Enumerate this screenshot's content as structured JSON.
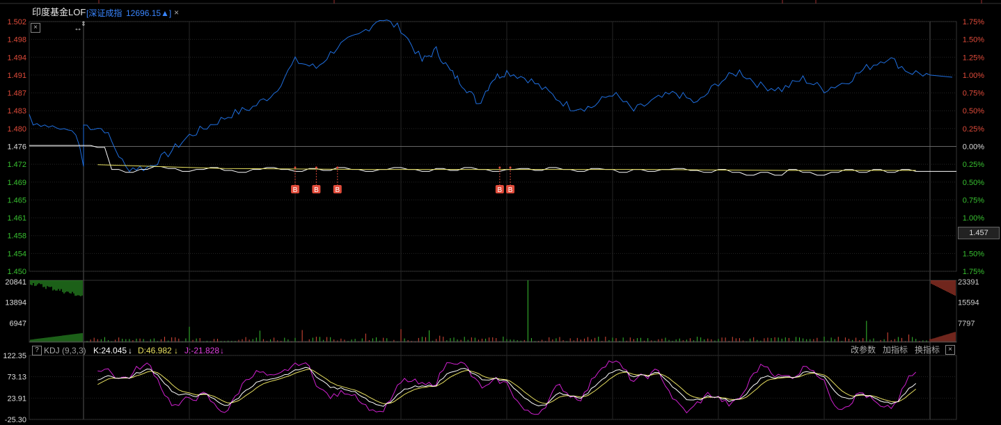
{
  "header": {
    "fund_name": "印度基金LOF",
    "index_name": "[深证成指",
    "index_value": "12696.15",
    "index_arrow": "▲]",
    "close_glyph": "×"
  },
  "price_badge": "1.457",
  "kdj": {
    "help": "?",
    "label": "KDJ",
    "params": "(9,3,3)",
    "k": "K:24.045",
    "k_arrow": "↓",
    "d": "D:46.982",
    "d_arrow": "↓",
    "j": "J:-21.828",
    "j_arrow": "↓",
    "btn_params": "改参数",
    "btn_add": "加指标",
    "btn_switch": "换指标",
    "btn_close": "×"
  },
  "colors": {
    "background": "#000000",
    "grid": "#2a2a2a",
    "price_line": "#ffffff",
    "avg_line": "#e8e060",
    "index_line": "#1f6fe0",
    "up": "#e04b3a",
    "down": "#38c030",
    "k_line": "#ffffff",
    "d_line": "#e8e060",
    "j_line": "#d020d0",
    "marker": "#e04b3a"
  },
  "chart_data": [
    {
      "type": "line",
      "name": "intraday-price",
      "ylim": [
        1.45,
        1.502
      ],
      "y_ticks_left": [
        "1.502",
        "1.498",
        "1.494",
        "1.491",
        "1.487",
        "1.483",
        "1.480",
        "1.476",
        "1.472",
        "1.469",
        "1.465",
        "1.461",
        "1.458",
        "1.454",
        "1.450"
      ],
      "y_ticks_right": [
        "1.75%",
        "1.50%",
        "1.25%",
        "1.00%",
        "0.75%",
        "0.50%",
        "0.25%",
        "0.00%",
        "0.25%",
        "0.50%",
        "0.75%",
        "1.00%",
        "1.25%",
        "1.50%",
        "1.75%"
      ],
      "price_x": [
        0,
        4,
        8,
        12,
        16,
        20,
        24,
        28,
        32,
        36,
        40,
        44,
        48,
        52,
        56,
        60,
        64,
        68,
        72,
        76,
        80,
        84,
        88,
        92,
        96,
        100,
        104,
        108,
        112,
        116,
        120,
        124,
        128,
        132,
        136,
        140,
        144,
        148,
        152,
        156,
        160,
        164,
        168,
        172,
        176,
        180,
        184,
        188,
        192,
        196,
        200,
        204,
        208,
        212,
        216,
        220,
        224,
        228,
        232,
        236,
        240
      ],
      "price_y": [
        1.4762,
        1.4758,
        1.4712,
        1.4706,
        1.4712,
        1.4718,
        1.4714,
        1.4708,
        1.4712,
        1.4716,
        1.471,
        1.4706,
        1.4712,
        1.4716,
        1.4712,
        1.4708,
        1.4714,
        1.471,
        1.4716,
        1.4712,
        1.4708,
        1.4712,
        1.4716,
        1.4712,
        1.4708,
        1.4714,
        1.471,
        1.4716,
        1.4712,
        1.4708,
        1.4712,
        1.4714,
        1.471,
        1.4716,
        1.4712,
        1.4708,
        1.4714,
        1.4712,
        1.4706,
        1.4712,
        1.4708,
        1.4712,
        1.4714,
        1.471,
        1.4706,
        1.4712,
        1.4706,
        1.47,
        1.4706,
        1.47,
        1.4712,
        1.4706,
        1.47,
        1.4706,
        1.4712,
        1.4706,
        1.4712,
        1.4706,
        1.4712,
        1.4708,
        1.4708
      ],
      "avg_x": [
        4,
        40,
        80,
        120,
        160,
        200,
        236
      ],
      "avg_y": [
        1.4722,
        1.4714,
        1.4712,
        1.4712,
        1.4712,
        1.471,
        1.471
      ],
      "buy_marker_minutes": [
        60,
        66,
        72,
        118,
        121
      ],
      "buy_marker_label": "B"
    },
    {
      "type": "line",
      "name": "shenzhen-index-relative",
      "unit": "percent",
      "ylim": [
        -1.75,
        1.75
      ],
      "x": [
        0,
        6,
        12,
        18,
        24,
        30,
        36,
        42,
        48,
        54,
        60,
        66,
        72,
        78,
        84,
        90,
        96,
        100,
        104,
        108,
        112,
        116,
        120,
        126,
        132,
        138,
        144,
        150,
        156,
        162,
        168,
        174,
        180,
        186,
        192,
        198,
        204,
        210,
        216,
        222,
        228,
        234,
        240
      ],
      "y": [
        0.3,
        0.24,
        -0.3,
        -0.3,
        -0.1,
        0.15,
        0.3,
        0.45,
        0.55,
        0.75,
        1.2,
        1.1,
        1.4,
        1.55,
        1.8,
        1.65,
        1.2,
        1.35,
        1.05,
        0.85,
        0.6,
        0.95,
        1.05,
        0.95,
        0.75,
        0.55,
        0.55,
        0.75,
        0.5,
        0.65,
        0.75,
        0.6,
        0.9,
        1.05,
        0.85,
        0.8,
        0.95,
        0.8,
        0.9,
        1.1,
        1.25,
        1.05,
        1.0
      ]
    },
    {
      "type": "bar",
      "name": "volume",
      "ylim": [
        0,
        20841
      ],
      "y_ticks_left": [
        "20841",
        "13894",
        "6947"
      ],
      "y_ticks_right": [
        "23391",
        "15594",
        "7797"
      ]
    },
    {
      "type": "line",
      "name": "kdj",
      "ylim": [
        -25.3,
        122.35
      ],
      "y_ticks_left": [
        "122.35",
        "73.13",
        "23.91",
        "-25.30"
      ],
      "series": [
        {
          "name": "K"
        },
        {
          "name": "D"
        },
        {
          "name": "J"
        }
      ]
    }
  ]
}
